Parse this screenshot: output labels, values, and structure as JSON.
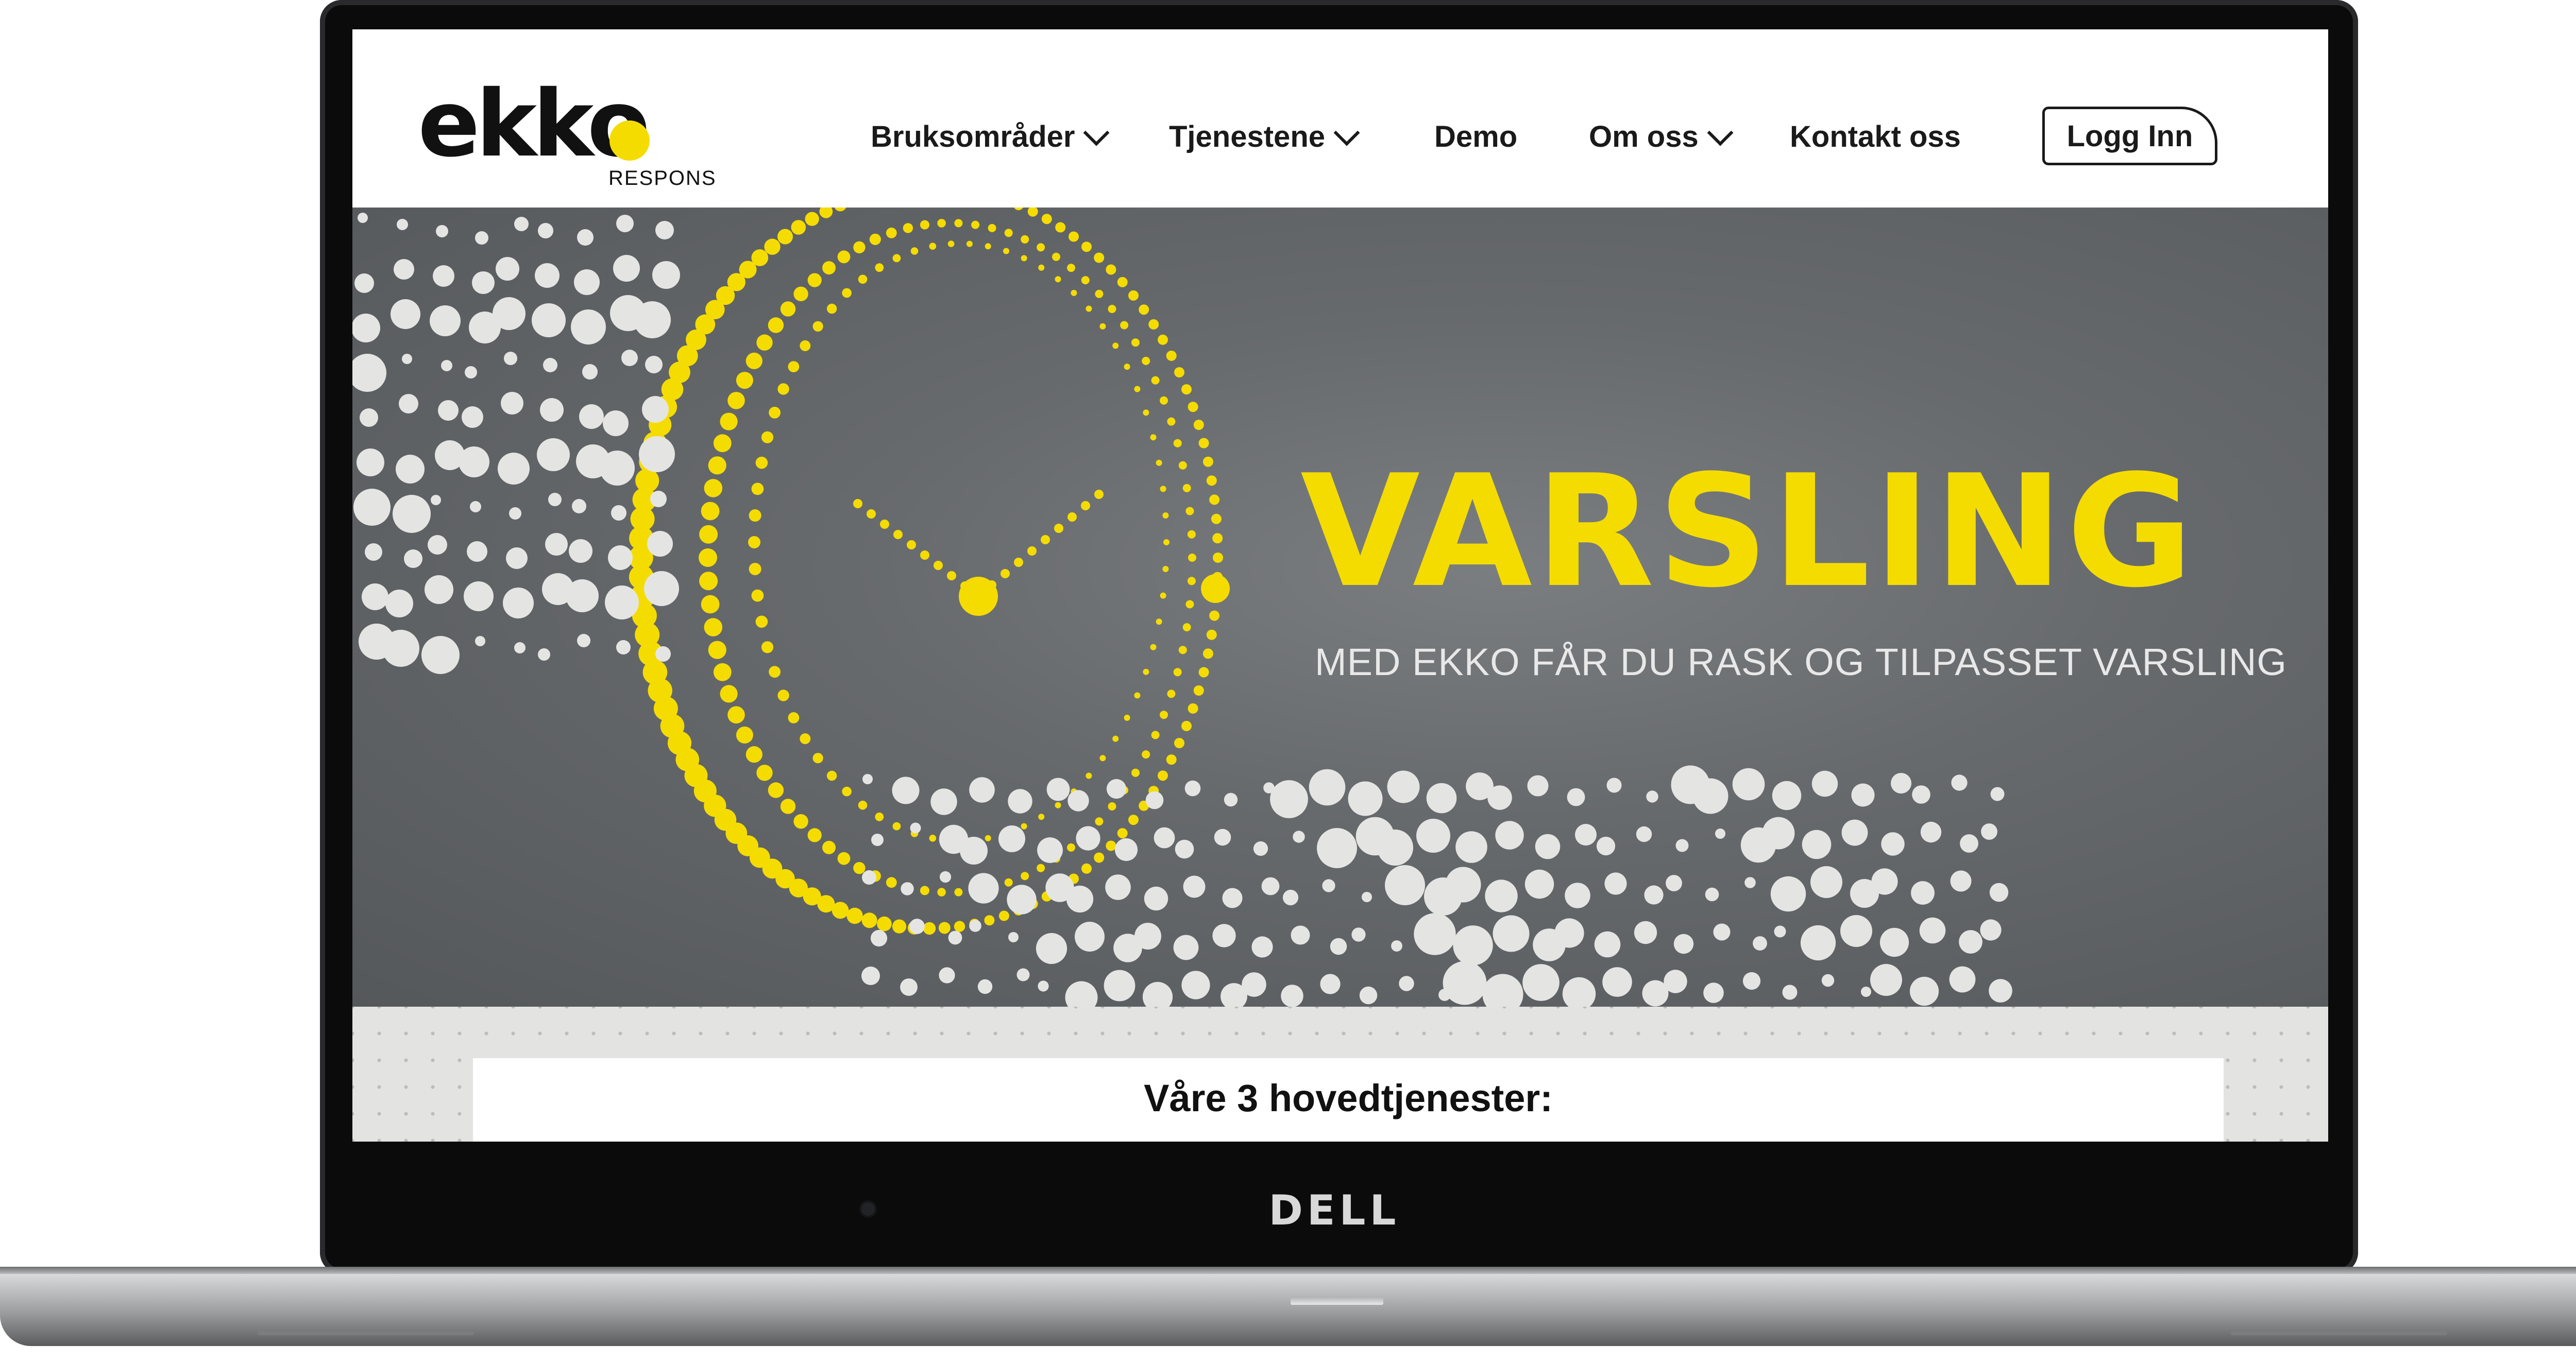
{
  "device": {
    "brand": "DELL"
  },
  "header": {
    "logo_text": "ekko",
    "logo_sub": "RESPONS",
    "nav": [
      {
        "label": "Bruksområder",
        "has_dropdown": true
      },
      {
        "label": "Tjenestene",
        "has_dropdown": true
      },
      {
        "label": "Demo",
        "has_dropdown": false
      },
      {
        "label": "Om oss",
        "has_dropdown": true
      },
      {
        "label": "Kontakt oss",
        "has_dropdown": false
      }
    ],
    "login_label": "Logg Inn"
  },
  "hero": {
    "title": "VARSLING",
    "subtitle": "MED EKKO FÅR DU RASK OG TILPASSET VARSLING"
  },
  "services": {
    "title": "Våre 3 hovedtjenester:"
  },
  "colors": {
    "brand_yellow": "#f5dc00",
    "hero_gray": "#676a6d",
    "text_dark": "#111111"
  }
}
